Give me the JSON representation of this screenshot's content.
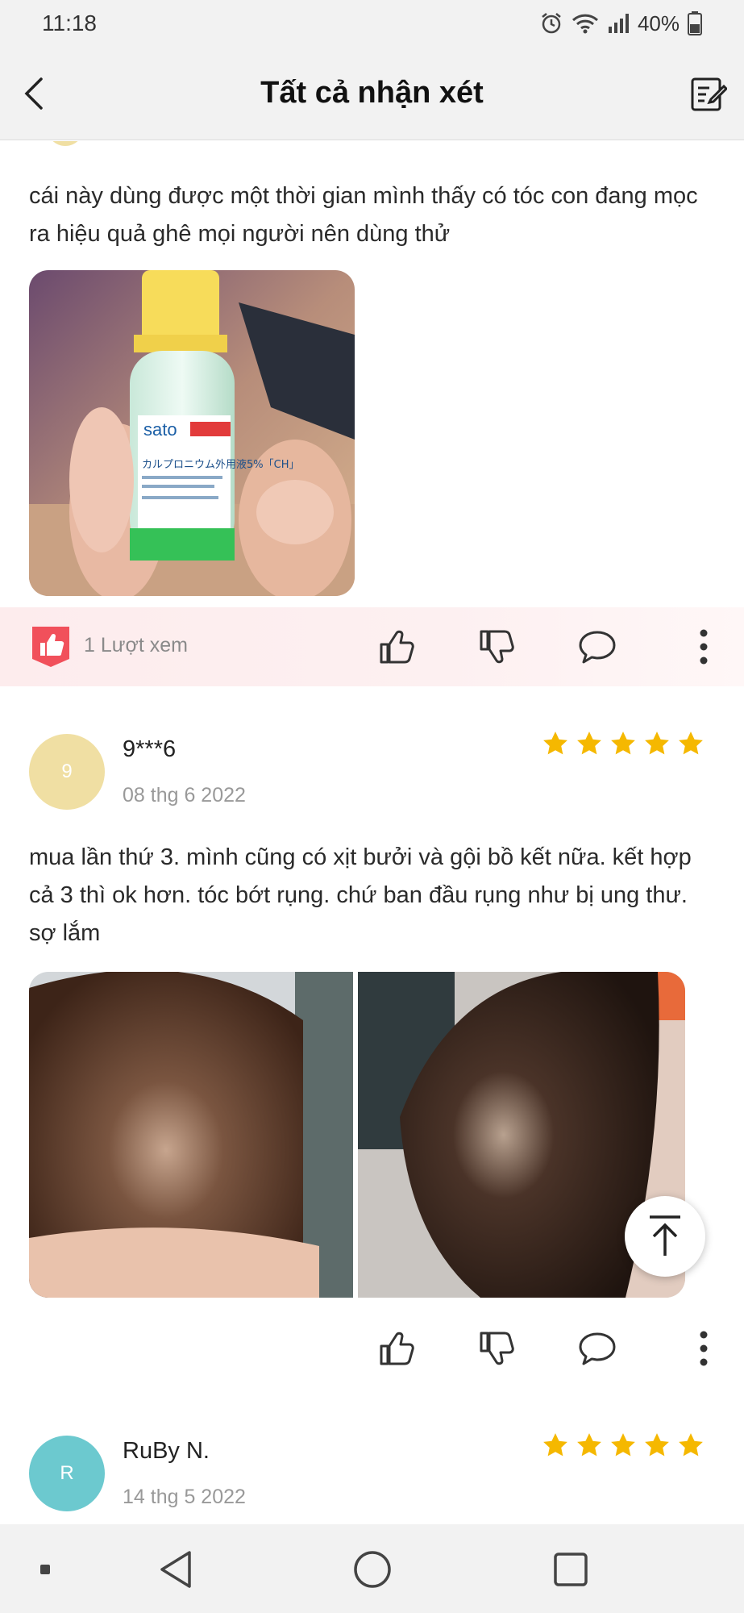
{
  "status_bar": {
    "time": "11:18",
    "battery": "40%"
  },
  "header": {
    "title": "Tất cả nhận xét"
  },
  "reviews": [
    {
      "text": "cái này dùng được một thời gian mình thấy có tóc con đang mọc ra hiệu quả ghê mọi người nên dùng thử",
      "photo_label": "sato",
      "photo_caption": "カルプロニウム外用液5%「CH」",
      "views": "1 Lượt xem"
    },
    {
      "avatar_letter": "9",
      "username": "9***6",
      "date": "08 thg 6 2022",
      "rating": 5,
      "text": "mua lần thứ 3. mình cũng có xịt bưởi và gội bồ kết nữa. kết hợp cả 3 thì ok hơn. tóc bớt rụng. chứ ban đầu rụng như bị ung thư. sợ lắm"
    },
    {
      "avatar_letter": "R",
      "username": "RuBy N.",
      "date": "14 thg 5 2022",
      "rating": 5
    }
  ],
  "colors": {
    "star": "#f5b800",
    "avatar_9": "#f0dfa3",
    "avatar_r": "#6cc9cf",
    "heart_badge": "#f1505b"
  }
}
